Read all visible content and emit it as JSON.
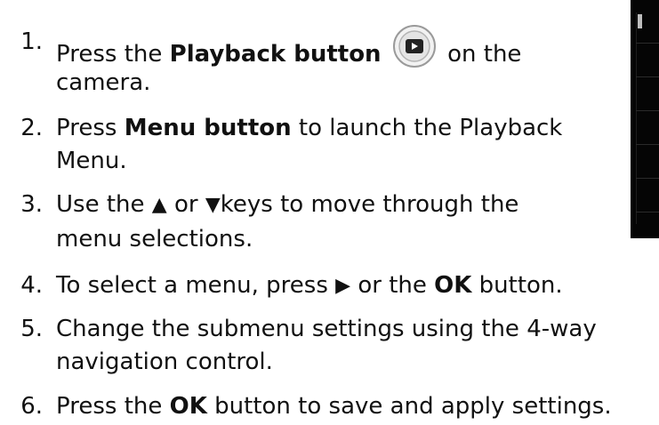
{
  "steps": [
    {
      "num": "1.",
      "t1": "Press the ",
      "b1": "Playback button",
      "t2": " on the",
      "line2": "camera."
    },
    {
      "num": "2.",
      "t1": "Press ",
      "b1": "Menu button",
      "t2": " to launch the Playback",
      "line2": "Menu."
    },
    {
      "num": "3.",
      "t1": "Use the ",
      "t2": " or ",
      "t3": "keys to move through the",
      "line2": "menu selections."
    },
    {
      "num": "4.",
      "t1": "To select a menu, press ",
      "t2": " or the ",
      "b1": "OK",
      "t3": " button."
    },
    {
      "num": "5.",
      "t1": "Change the submenu settings using the 4-way",
      "line2": "navigation control."
    },
    {
      "num": "6.",
      "t1": "Press the ",
      "b1": "OK",
      "t2": " button to save and apply settings."
    }
  ],
  "icons": {
    "playback": "playback-button-icon",
    "up": "up-arrow-icon",
    "down": "down-arrow-icon",
    "right": "right-arrow-icon"
  },
  "colors": {
    "text": "#111111",
    "screen": "#050505"
  }
}
